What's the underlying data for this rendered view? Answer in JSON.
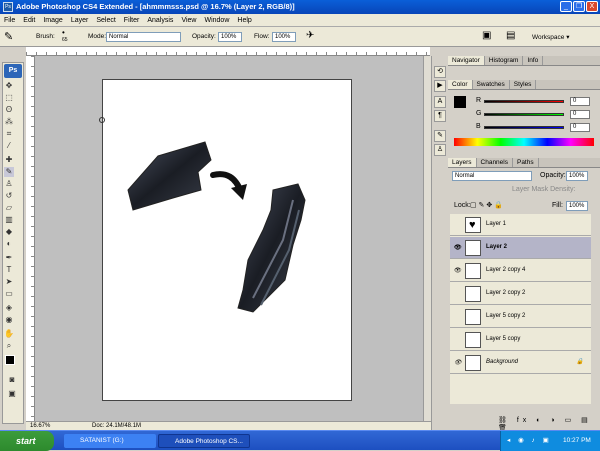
{
  "window": {
    "title": "Adobe Photoshop CS4 Extended - [ahmmmsss.psd @ 16.7% (Layer 2, RGB/8)]",
    "minimize": "_",
    "restore": "❐",
    "close": "X"
  },
  "menu": [
    "File",
    "Edit",
    "Image",
    "Layer",
    "Select",
    "Filter",
    "Analysis",
    "View",
    "Window",
    "Help"
  ],
  "options": {
    "brush_label": "Brush:",
    "brush_size": "65",
    "mode_label": "Mode:",
    "mode_value": "Normal",
    "opacity_label": "Opacity:",
    "opacity_value": "100%",
    "flow_label": "Flow:",
    "flow_value": "100%",
    "workspace": "Workspace ▾"
  },
  "app_logo": "Ps",
  "status": {
    "zoom": "16.67%",
    "doc": "Doc: 24.1M/48.1M"
  },
  "navigator_tabs": [
    "Navigator",
    "Histogram",
    "Info"
  ],
  "color_tabs": [
    "Color",
    "Swatches",
    "Styles"
  ],
  "color": {
    "r_label": "R",
    "g_label": "G",
    "b_label": "B",
    "r": "0",
    "g": "0",
    "b": "0",
    "fg": "#000000",
    "bg": "#ffffff"
  },
  "layers_tabs": [
    "Layers",
    "Channels",
    "Paths"
  ],
  "layers_panel": {
    "blend_mode": "Normal",
    "opacity_label": "Opacity:",
    "opacity": "100%",
    "mask_density_label": "Layer Mask Density:",
    "lock_label": "Lock:",
    "fill_label": "Fill:",
    "fill": "100%"
  },
  "layers": [
    {
      "name": "Layer 1",
      "visible": false,
      "selected": false
    },
    {
      "name": "Layer 2",
      "visible": true,
      "selected": true
    },
    {
      "name": "Layer 2 copy 4",
      "visible": true,
      "selected": false
    },
    {
      "name": "Layer 2 copy 2",
      "visible": false,
      "selected": false
    },
    {
      "name": "Layer 5 copy 2",
      "visible": false,
      "selected": false
    },
    {
      "name": "Layer 5 copy",
      "visible": false,
      "selected": false
    },
    {
      "name": "Background",
      "visible": true,
      "selected": false
    }
  ],
  "taskbar": {
    "start": "start",
    "items": [
      "SATANIST (G:)",
      "Adobe Photoshop CS..."
    ],
    "clock": "10:27 PM"
  }
}
